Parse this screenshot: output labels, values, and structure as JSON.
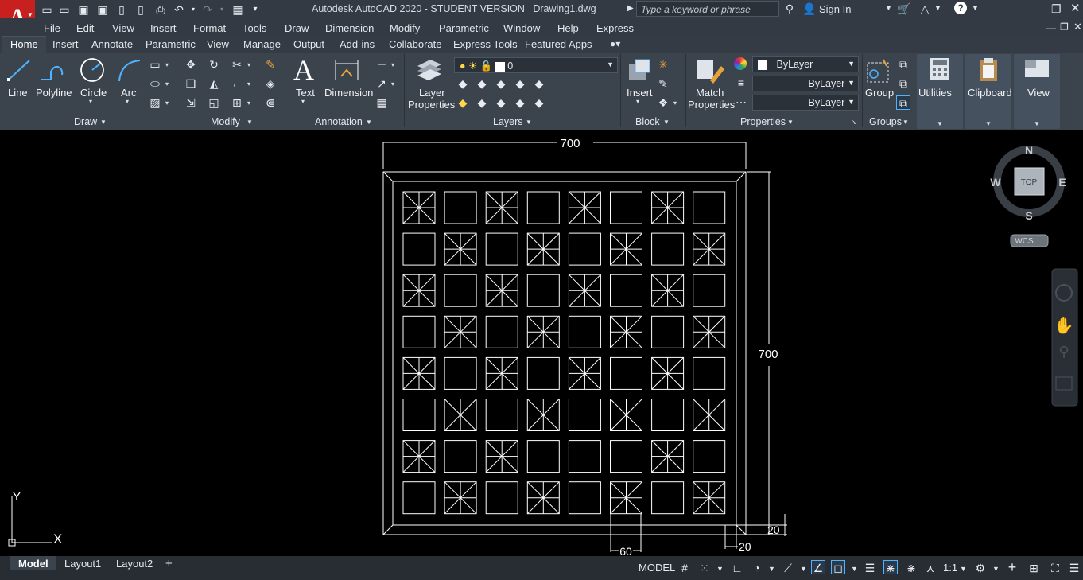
{
  "app": {
    "logo": "A",
    "title": "Autodesk AutoCAD 2020 - STUDENT VERSION",
    "file": "Drawing1.dwg",
    "search_placeholder": "Type a keyword or phrase",
    "sign_in": "Sign In"
  },
  "menu": [
    "File",
    "Edit",
    "View",
    "Insert",
    "Format",
    "Tools",
    "Draw",
    "Dimension",
    "Modify",
    "Parametric",
    "Window",
    "Help",
    "Express"
  ],
  "tabs": [
    "Home",
    "Insert",
    "Annotate",
    "Parametric",
    "View",
    "Manage",
    "Output",
    "Add-ins",
    "Collaborate",
    "Express Tools",
    "Featured Apps"
  ],
  "draw": {
    "line": "Line",
    "polyline": "Polyline",
    "circle": "Circle",
    "arc": "Arc",
    "panel": "Draw"
  },
  "modify": {
    "panel": "Modify"
  },
  "annotation": {
    "text": "Text",
    "dimension": "Dimension",
    "panel": "Annotation"
  },
  "layers": {
    "properties": "Layer",
    "properties2": "Properties",
    "current": "0",
    "panel": "Layers"
  },
  "block": {
    "insert": "Insert",
    "panel": "Block"
  },
  "properties": {
    "match": "Match",
    "match2": "Properties",
    "color": "ByLayer",
    "linetype": "ByLayer",
    "lineweight": "ByLayer",
    "panel": "Properties"
  },
  "groups": {
    "group": "Group",
    "panel": "Groups"
  },
  "utilities": {
    "label": "Utilities"
  },
  "clipboard": {
    "label": "Clipboard"
  },
  "view": {
    "label": "View"
  },
  "drawing": {
    "dim_top": "700",
    "dim_right": "700",
    "dim_bottom_60": "60",
    "dim_bottom_20": "20",
    "dim_right_20": "20",
    "pattern_rows": [
      [
        1,
        0,
        1,
        0,
        1,
        0,
        1,
        0
      ],
      [
        0,
        1,
        0,
        1,
        0,
        1,
        0,
        1
      ],
      [
        1,
        0,
        1,
        0,
        1,
        0,
        1,
        0
      ],
      [
        0,
        1,
        0,
        1,
        0,
        1,
        0,
        1
      ],
      [
        1,
        0,
        1,
        0,
        1,
        0,
        1,
        0
      ],
      [
        0,
        1,
        0,
        1,
        0,
        1,
        0,
        1
      ],
      [
        1,
        0,
        1,
        0,
        0,
        0,
        1,
        0
      ],
      [
        0,
        1,
        0,
        1,
        0,
        1,
        0,
        1
      ]
    ]
  },
  "viewcube": {
    "n": "N",
    "s": "S",
    "e": "E",
    "w": "W",
    "top": "TOP",
    "wcs": "WCS"
  },
  "ucs": {
    "x": "X",
    "y": "Y"
  },
  "status": {
    "model": "Model",
    "layout1": "Layout1",
    "layout2": "Layout2",
    "plus": "+",
    "space": "MODEL",
    "scale": "1:1"
  },
  "colors": {
    "bg": "#000000",
    "ribbon": "#3b434d",
    "title": "#333a43",
    "accent": "#c8201f",
    "status": "#282d34"
  }
}
